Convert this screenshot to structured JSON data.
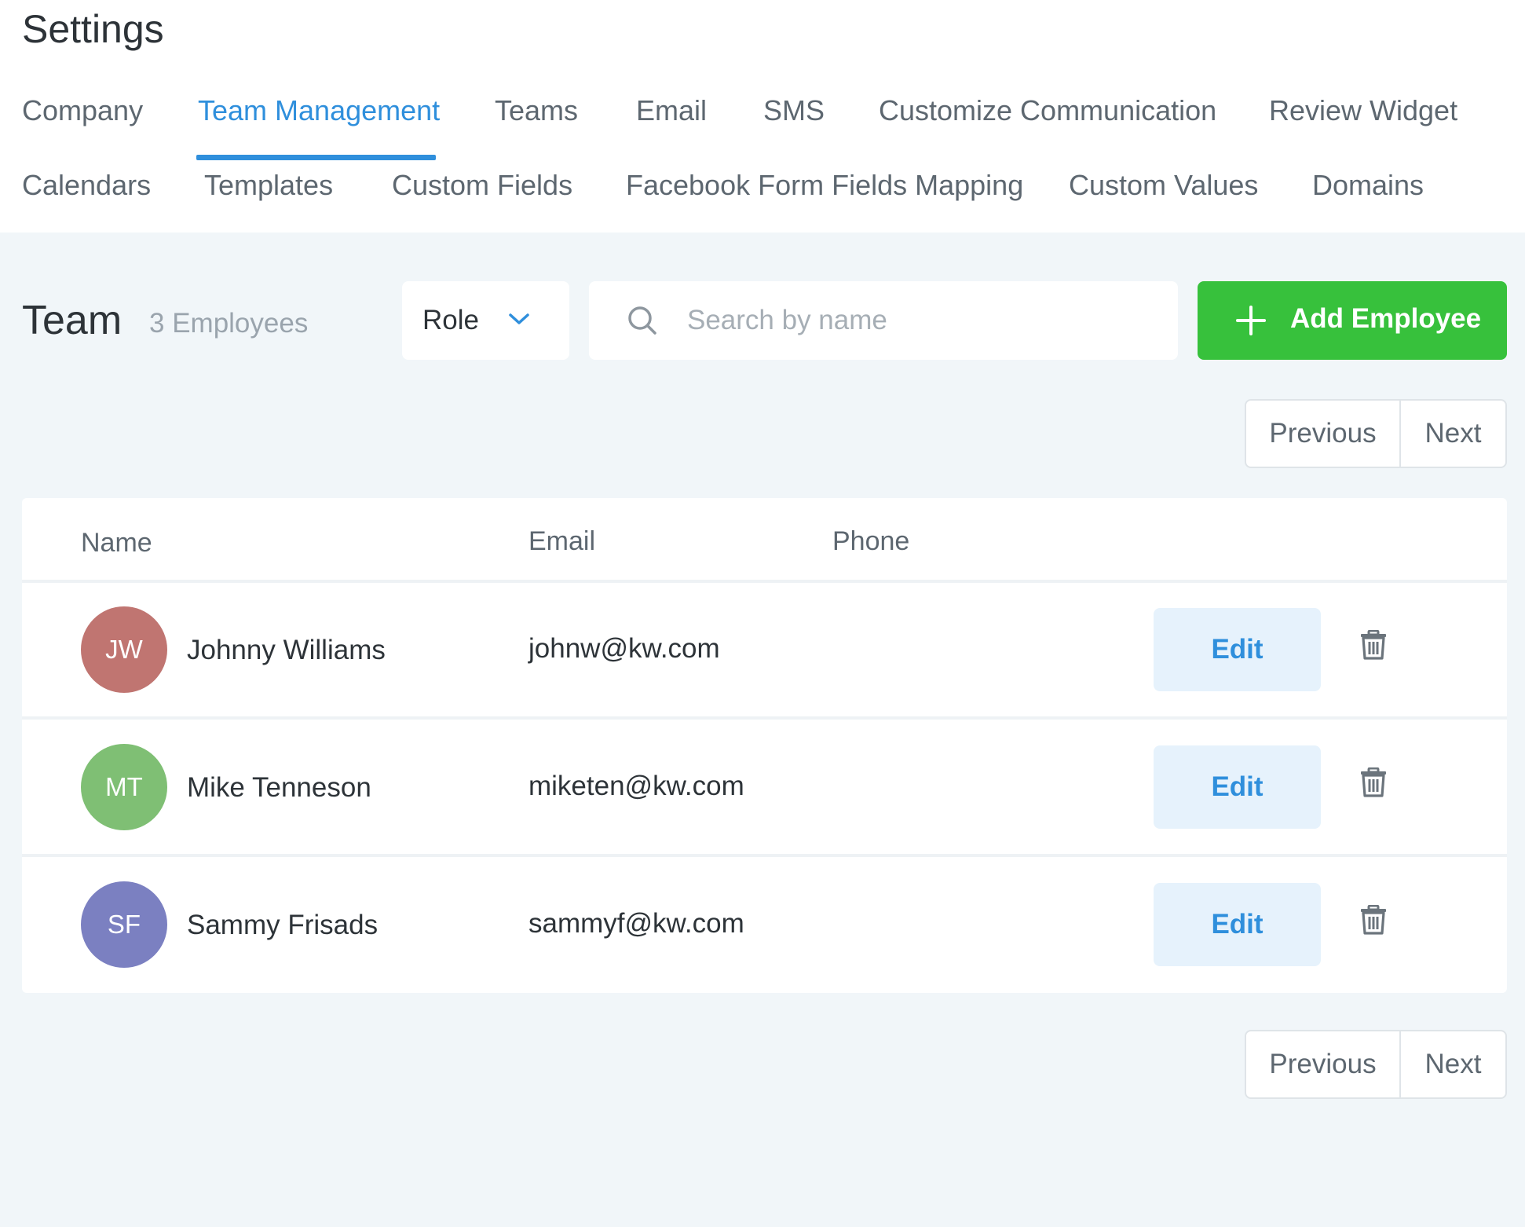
{
  "page": {
    "title": "Settings"
  },
  "tabs": [
    {
      "label": "Company",
      "active": false
    },
    {
      "label": "Team Management",
      "active": true
    },
    {
      "label": "Teams",
      "active": false
    },
    {
      "label": "Email",
      "active": false
    },
    {
      "label": "SMS",
      "active": false
    },
    {
      "label": "Customize Communication",
      "active": false
    },
    {
      "label": "Review Widget",
      "active": false
    },
    {
      "label": "Calendars",
      "active": false
    },
    {
      "label": "Templates",
      "active": false
    },
    {
      "label": "Custom Fields",
      "active": false
    },
    {
      "label": "Facebook Form Fields Mapping",
      "active": false
    },
    {
      "label": "Custom Values",
      "active": false
    },
    {
      "label": "Domains",
      "active": false
    }
  ],
  "team": {
    "title": "Team",
    "count_label": "3 Employees",
    "role_filter": "Role",
    "search_placeholder": "Search by name",
    "add_button": "Add Employee"
  },
  "pagination": {
    "previous": "Previous",
    "next": "Next"
  },
  "table": {
    "columns": [
      "Name",
      "Email",
      "Phone"
    ],
    "rows": [
      {
        "initials": "JW",
        "name": "Johnny Williams",
        "email": "johnw@kw.com",
        "phone": "",
        "edit": "Edit"
      },
      {
        "initials": "MT",
        "name": "Mike Tenneson",
        "email": "miketen@kw.com",
        "phone": "",
        "edit": "Edit"
      },
      {
        "initials": "SF",
        "name": "Sammy Frisads",
        "email": "sammyf@kw.com",
        "phone": "",
        "edit": "Edit"
      }
    ]
  },
  "colors": {
    "accent": "#2f8fdc",
    "add_button": "#37c13c",
    "avatars": [
      "#c07571",
      "#7fbf74",
      "#7b80c1"
    ]
  },
  "icons": {
    "role_dropdown": "chevron-down-icon",
    "search": "search-icon",
    "add": "plus-icon",
    "delete": "trash-icon"
  }
}
